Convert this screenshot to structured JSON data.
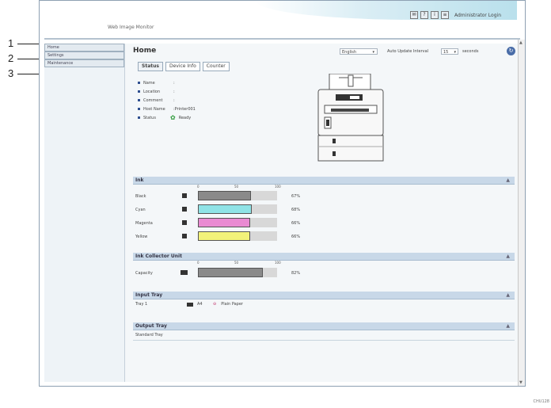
{
  "header": {
    "app_title": "Web Image Monitor",
    "admin_login": "Administrator Login",
    "icons": [
      "mail-icon",
      "help-icon",
      "info-icon",
      "bookmark-icon"
    ]
  },
  "callouts": [
    "1",
    "2",
    "3"
  ],
  "sidebar": {
    "items": [
      {
        "label": "Home"
      },
      {
        "label": "Settings"
      },
      {
        "label": "Maintenance"
      }
    ]
  },
  "main": {
    "title": "Home",
    "language": "English",
    "auto_update_label": "Auto Update Interval",
    "interval_value": "15",
    "seconds_label": "seconds",
    "tabs": [
      {
        "label": "Status"
      },
      {
        "label": "Device Info"
      },
      {
        "label": "Counter"
      }
    ],
    "properties": [
      {
        "label": "Name",
        "value": ":"
      },
      {
        "label": "Location",
        "value": ":"
      },
      {
        "label": "Comment",
        "value": ":"
      },
      {
        "label": "Host Name",
        "value": ":Printer001"
      },
      {
        "label": "Status",
        "value": "Ready"
      }
    ]
  },
  "ink": {
    "title": "Ink",
    "scale": [
      "0",
      "50",
      "100"
    ],
    "rows": [
      {
        "label": "Black",
        "level": 0.67,
        "pct": "67%",
        "color": "#8a8a8a"
      },
      {
        "label": "Cyan",
        "level": 0.68,
        "pct": "68%",
        "color": "#8fe3e6"
      },
      {
        "label": "Magenta",
        "level": 0.66,
        "pct": "66%",
        "color": "#e98ad2"
      },
      {
        "label": "Yellow",
        "level": 0.66,
        "pct": "66%",
        "color": "#f2f27a"
      }
    ]
  },
  "ink_collector": {
    "title": "Ink Collector Unit",
    "scale": [
      "0",
      "50",
      "100"
    ],
    "rows": [
      {
        "label": "Capacity",
        "level": 0.82,
        "pct": "82%",
        "color": "#8a8a8a"
      }
    ]
  },
  "input_tray": {
    "title": "Input Tray",
    "rows": [
      {
        "name": "Tray 1",
        "size": "A4",
        "type": "Plain Paper"
      }
    ]
  },
  "output_tray": {
    "title": "Output Tray",
    "rows": [
      {
        "name": "Standard Tray"
      }
    ]
  },
  "figure_id": "CHU128"
}
